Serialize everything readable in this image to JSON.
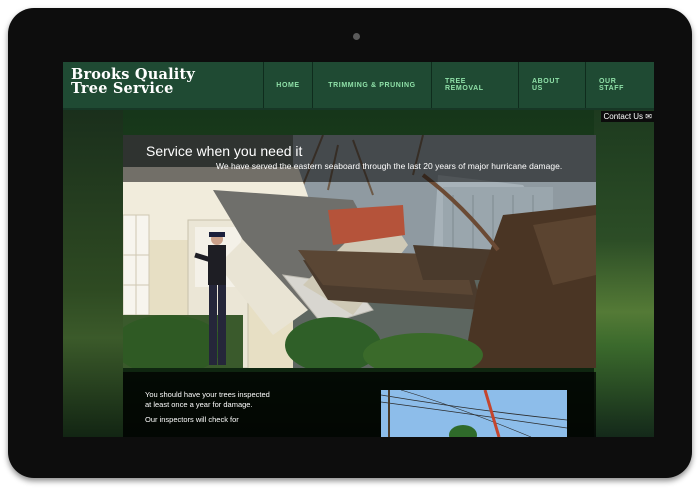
{
  "site": {
    "logo_line1": "Brooks Quality",
    "logo_line2": "Tree Service"
  },
  "nav": {
    "items": [
      "Home",
      "Trimming & Pruning",
      "Tree Removal",
      "About Us",
      "Our Staff"
    ]
  },
  "contact": {
    "label": "Contact Us",
    "icon": "mail-icon"
  },
  "hero": {
    "title": "Service when you need it",
    "subtitle": "We have served the eastern seaboard through the last 20 years of major hurricane damage."
  },
  "content": {
    "paragraph1": "You should have your trees inspected at least once a year for damage.",
    "paragraph2": "Our inspectors will check for"
  },
  "colors": {
    "header": "#1f4a33",
    "nav_text": "#8fe0a8",
    "device": "#0d0d0d"
  }
}
